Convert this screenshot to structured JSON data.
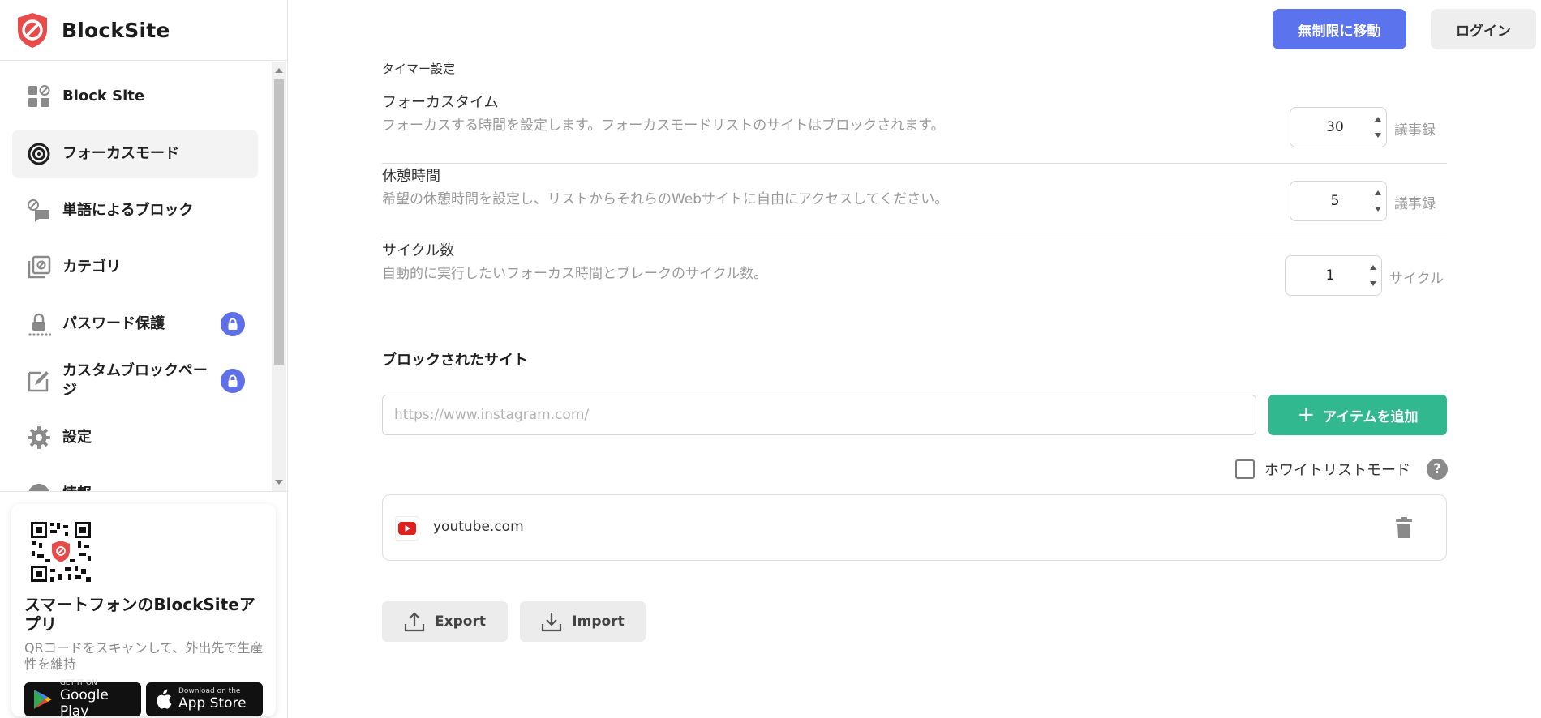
{
  "brand": {
    "name": "BlockSite",
    "accent": "#e94b4b"
  },
  "sidebar": {
    "items": [
      {
        "label": "Block Site",
        "icon": "block-grid-icon",
        "active": false,
        "locked": false
      },
      {
        "label": "フォーカスモード",
        "icon": "target-icon",
        "active": true,
        "locked": false
      },
      {
        "label": "単語によるブロック",
        "icon": "word-block-icon",
        "active": false,
        "locked": false
      },
      {
        "label": "カテゴリ",
        "icon": "category-icon",
        "active": false,
        "locked": false
      },
      {
        "label": "パスワード保護",
        "icon": "password-lock-icon",
        "active": false,
        "locked": true
      },
      {
        "label": "カスタムブロックページ",
        "icon": "custom-page-icon",
        "active": false,
        "locked": true
      },
      {
        "label": "設定",
        "icon": "gear-icon",
        "active": false,
        "locked": false
      },
      {
        "label": "情報",
        "icon": "info-icon",
        "active": false,
        "locked": false
      }
    ],
    "promo": {
      "title": "スマートフォンのBlockSiteアプリ",
      "description": "QRコードをスキャンして、外出先で生産性を維持",
      "google_play": {
        "small": "GET IT ON",
        "big": "Google Play"
      },
      "app_store": {
        "small": "Download on the",
        "big": "App Store"
      }
    }
  },
  "header": {
    "unlimited_label": "無制限に移動",
    "login_label": "ログイン",
    "unlimited_color": "#5b74ee"
  },
  "timer": {
    "heading": "タイマー設定",
    "rows": [
      {
        "title": "フォーカスタイム",
        "description": "フォーカスする時間を設定します。フォーカスモードリストのサイトはブロックされます。",
        "value": "30",
        "unit": "議事録"
      },
      {
        "title": "休憩時間",
        "description": "希望の休憩時間を設定し、リストからそれらのWebサイトに自由にアクセスしてください。",
        "value": "5",
        "unit": "議事録"
      },
      {
        "title": "サイクル数",
        "description": "自動的に実行したいフォーカス時間とブレークのサイクル数。",
        "value": "1",
        "unit": "サイクル"
      }
    ]
  },
  "blocked": {
    "heading": "ブロックされたサイト",
    "input_placeholder": "https://www.instagram.com/",
    "add_label": "アイテムを追加",
    "add_color": "#32b88f",
    "whitelist_label": "ホワイトリストモード",
    "help_glyph": "?",
    "sites": [
      {
        "name": "youtube.com",
        "icon": "youtube-icon"
      }
    ]
  },
  "actions": {
    "export_label": "Export",
    "import_label": "Import"
  }
}
